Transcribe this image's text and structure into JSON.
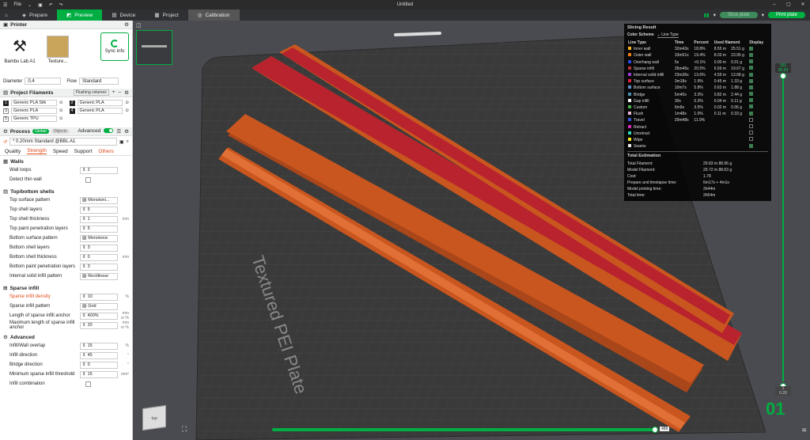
{
  "titlebar": {
    "menu": "File",
    "title": "Untitled"
  },
  "tabs": [
    {
      "label": "Prepare",
      "icon": "cube-icon"
    },
    {
      "label": "Preview",
      "icon": "preview-icon"
    },
    {
      "label": "Device",
      "icon": "device-icon"
    },
    {
      "label": "Project",
      "icon": "project-icon"
    },
    {
      "label": "Calibration",
      "icon": "calibration-icon"
    }
  ],
  "actions": {
    "slice": "Slice plate",
    "print": "Print plate"
  },
  "printer": {
    "header": "Printer",
    "model": "Bambu Lab A1",
    "plate": "Texture...",
    "sync": "Sync info",
    "diameter_label": "Diameter",
    "diameter_value": "0.4",
    "flow_label": "Flow",
    "flow_value": "Standard"
  },
  "filaments": {
    "header": "Project Filaments",
    "flushing": "Flushing volumes",
    "items": [
      {
        "num": "1",
        "name": "Generic PLA Silk",
        "color": "#222222"
      },
      {
        "num": "2",
        "name": "Generic PLA",
        "color": "#222222"
      },
      {
        "num": "3",
        "name": "Generic PLA",
        "color": "#ffffff"
      },
      {
        "num": "4",
        "name": "Generic PLA",
        "color": "#222222"
      },
      {
        "num": "5",
        "name": "Generic TPU",
        "color": "#ffffff"
      }
    ]
  },
  "process": {
    "header": "Process",
    "global": "Global",
    "objects": "Objects",
    "advanced": "Advanced",
    "preset": "* 0.20mm Standard @BBL A1",
    "subtabs": [
      "Quality",
      "Strength",
      "Speed",
      "Support",
      "Others"
    ],
    "walls": {
      "title": "Walls",
      "wall_loops_label": "Wall loops",
      "wall_loops": "2",
      "detect_thin_label": "Detect thin wall"
    },
    "topbottom": {
      "title": "Top/bottom shells",
      "rows": [
        {
          "label": "Top surface pattern",
          "value": "Monotoni...",
          "unit": ""
        },
        {
          "label": "Top shell layers",
          "value": "5",
          "unit": ""
        },
        {
          "label": "Top shell thickness",
          "value": "1",
          "unit": "mm"
        },
        {
          "label": "Top paint penetration layers",
          "value": "5",
          "unit": ""
        },
        {
          "label": "Bottom surface pattern",
          "value": "Monotonic",
          "unit": ""
        },
        {
          "label": "Bottom shell layers",
          "value": "3",
          "unit": ""
        },
        {
          "label": "Bottom shell thickness",
          "value": "0",
          "unit": "mm"
        },
        {
          "label": "Bottom paint penetration layers",
          "value": "3",
          "unit": ""
        },
        {
          "label": "Internal solid infill pattern",
          "value": "Rectilinear",
          "unit": ""
        }
      ]
    },
    "sparse": {
      "title": "Sparse infill",
      "rows": [
        {
          "label": "Sparse infill density",
          "value": "10",
          "unit": "%"
        },
        {
          "label": "Sparse infill pattern",
          "value": "Grid",
          "unit": ""
        },
        {
          "label": "Length of sparse infill anchor",
          "value": "400%",
          "unit": "mm or %"
        },
        {
          "label": "Maximum length of sparse infill anchor",
          "value": "20",
          "unit": "mm or %"
        }
      ]
    },
    "advanced_group": {
      "title": "Advanced",
      "rows": [
        {
          "label": "Infill/Wall overlap",
          "value": "15",
          "unit": "%"
        },
        {
          "label": "Infill direction",
          "value": "45",
          "unit": "°"
        },
        {
          "label": "Bridge direction",
          "value": "0",
          "unit": "°"
        },
        {
          "label": "Minimum sparse infill threshold",
          "value": "15",
          "unit": "mm²"
        },
        {
          "label": "Infill combination",
          "value": "",
          "unit": ""
        }
      ]
    }
  },
  "plate_label": "Textured PEI Plate",
  "view_cube": "Top",
  "slicing": {
    "title": "Slicing Result",
    "scheme_label": "Color Scheme",
    "scheme_value": "Line Type",
    "headers": [
      "Line Type",
      "Time",
      "Percent",
      "Used filament",
      "Display"
    ],
    "rows": [
      {
        "type": "Inner wall",
        "time": "32m43s",
        "pct": "18.8%",
        "len": "8.55 m",
        "wt": "25.51 g",
        "color": "#f5b321",
        "on": true
      },
      {
        "type": "Outer wall",
        "time": "33m51s",
        "pct": "19.4%",
        "len": "8.03 m",
        "wt": "23.95 g",
        "color": "#ee7a14",
        "on": true
      },
      {
        "type": "Overhang wall",
        "time": "5s",
        "pct": "<0.1%",
        "len": "0.00 m",
        "wt": "0.01 g",
        "color": "#2848ea",
        "on": true
      },
      {
        "type": "Sparse infill",
        "time": "35m45s",
        "pct": "20.5%",
        "len": "6.59 m",
        "wt": "19.67 g",
        "color": "#b83030",
        "on": true
      },
      {
        "type": "Internal solid infill",
        "time": "23m36s",
        "pct": "13.6%",
        "len": "4.59 m",
        "wt": "13.68 g",
        "color": "#9a3ad6",
        "on": true
      },
      {
        "type": "Top surface",
        "time": "3m18s",
        "pct": "1.9%",
        "len": "0.45 m",
        "wt": "1.33 g",
        "color": "#e0213b",
        "on": true
      },
      {
        "type": "Bottom surface",
        "time": "10m7s",
        "pct": "5.8%",
        "len": "0.63 m",
        "wt": "1.88 g",
        "color": "#5e8fc8",
        "on": true
      },
      {
        "type": "Bridge",
        "time": "5m40s",
        "pct": "3.3%",
        "len": "0.82 m",
        "wt": "2.44 g",
        "color": "#4a8fb0",
        "on": true
      },
      {
        "type": "Gap infill",
        "time": "30s",
        "pct": "0.3%",
        "len": "0.04 m",
        "wt": "0.11 g",
        "color": "#ffffff",
        "on": true
      },
      {
        "type": "Custom",
        "time": "6m9s",
        "pct": "3.5%",
        "len": "0.02 m",
        "wt": "0.06 g",
        "color": "#46b34a",
        "on": true
      },
      {
        "type": "Flush",
        "time": "1m48s",
        "pct": "1.0%",
        "len": "0.11 m",
        "wt": "0.33 g",
        "color": "#e6b8d6",
        "on": true
      },
      {
        "type": "Travel",
        "time": "20m48s",
        "pct": "11.9%",
        "len": "",
        "wt": "",
        "color": "#3a52d8",
        "on": false
      },
      {
        "type": "Retract",
        "time": "",
        "pct": "",
        "len": "",
        "wt": "",
        "color": "#d82ab8",
        "on": false
      },
      {
        "type": "Unretract",
        "time": "",
        "pct": "",
        "len": "",
        "wt": "",
        "color": "#2ad8b8",
        "on": false
      },
      {
        "type": "Wipe",
        "time": "",
        "pct": "",
        "len": "",
        "wt": "",
        "color": "#f5e61a",
        "on": false
      },
      {
        "type": "Seams",
        "time": "",
        "pct": "",
        "len": "",
        "wt": "",
        "color": "#e8e8e8",
        "on": true
      }
    ],
    "estimation_title": "Total Estimation",
    "estimation": [
      {
        "label": "Total Filament:",
        "a": "29.83 m",
        "b": "88.96 g"
      },
      {
        "label": "Model Filament:",
        "a": "29.72 m",
        "b": "88.63 g"
      },
      {
        "label": "Cost:",
        "a": "1.78",
        "b": ""
      },
      {
        "label": "Prepare and timelapse time:",
        "a": "6m17s + 4m1s",
        "b": ""
      },
      {
        "label": "Model printing time:",
        "a": "2h44m",
        "b": ""
      },
      {
        "label": "Total time:",
        "a": "2h54m",
        "b": ""
      }
    ]
  },
  "layer_slider": {
    "top_layer": "151",
    "top_height": "30.20",
    "bottom_layer": "1",
    "bottom_height": "0.20",
    "big_label": "01"
  },
  "move_slider": {
    "value": "489"
  },
  "colors": {
    "accent": "#00ae42",
    "model": "#c9561f",
    "topsurface": "#b8232e"
  }
}
